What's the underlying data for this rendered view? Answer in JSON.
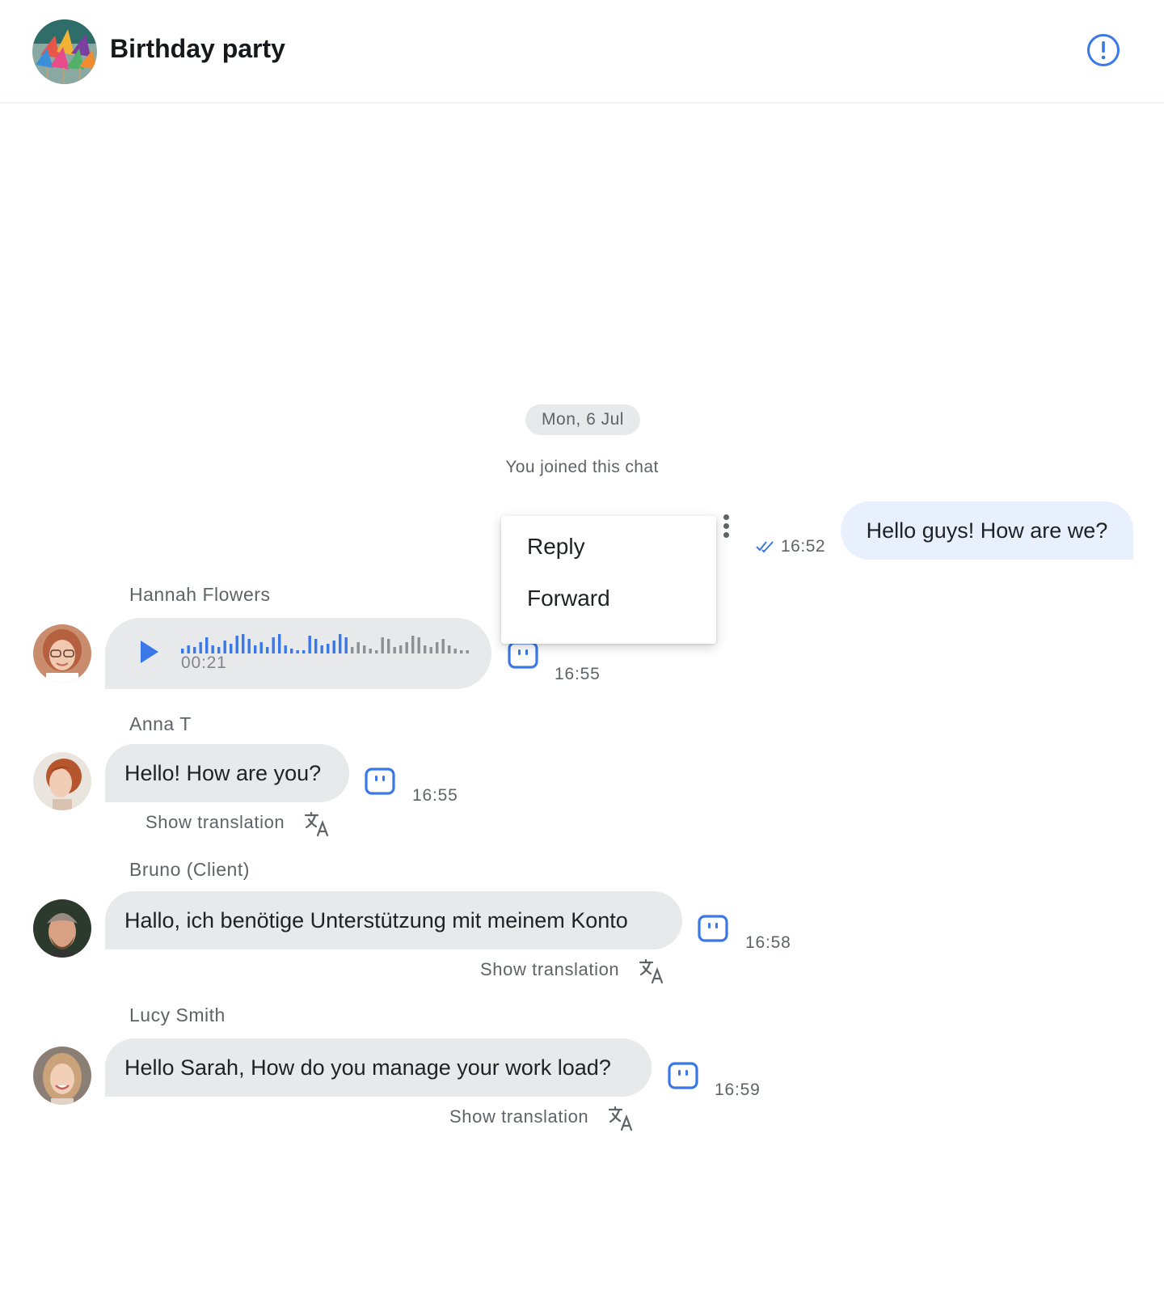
{
  "header": {
    "title": "Birthday party",
    "info_icon": "info-circle-icon"
  },
  "colors": {
    "accent": "#3b78e7",
    "own_bubble": "#e8effd",
    "incoming_bubble": "#e8e9eb",
    "muted_text": "#5f6368"
  },
  "chat": {
    "date_separator": "Mon, 6 Jul",
    "system_message": "You joined this chat",
    "own_message": {
      "text": "Hello guys! How are we?",
      "time": "16:52",
      "status_icon": "double-check-icon"
    },
    "context_menu": {
      "items": [
        "Reply",
        "Forward"
      ]
    },
    "voice_message": {
      "sender": "Hannah Flowers",
      "duration": "00:21",
      "played_fraction": 0.58,
      "time": "16:55"
    },
    "messages": [
      {
        "sender": "Anna T",
        "text": "Hello! How are you?",
        "time": "16:55",
        "action": "Show translation"
      },
      {
        "sender": "Bruno (Client)",
        "text": "Hallo, ich benötige Unterstützung mit meinem Konto",
        "time": "16:58",
        "action": "Show translation"
      },
      {
        "sender": "Lucy Smith",
        "text": "Hello Sarah, How do you manage your work load?",
        "time": "16:59",
        "action": "Show translation"
      }
    ]
  }
}
